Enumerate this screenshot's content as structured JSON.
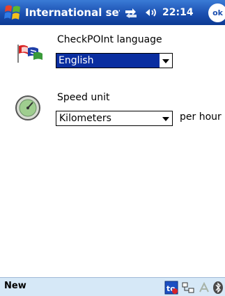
{
  "titlebar": {
    "title": "International setti",
    "clock": "22:14",
    "ok_label": "ok",
    "start_icon": "windows-flag-icon",
    "connectivity_icon": "connectivity-icon",
    "volume_icon": "speaker-icon"
  },
  "language": {
    "label": "CheckPOInt language",
    "selected": "English",
    "icon": "flags-icon"
  },
  "speed": {
    "label": "Speed unit",
    "selected": "Kilometers",
    "suffix": "per hour",
    "icon": "speedometer-icon"
  },
  "menubar": {
    "left_label": "New",
    "tray_icons": [
      "todo-icon",
      "network-icon",
      "connection-icon",
      "bluetooth-icon"
    ]
  },
  "colors": {
    "titlebar": "#1b4fb0",
    "selection": "#0a2ea0",
    "menubar": "#d6e8f7"
  }
}
